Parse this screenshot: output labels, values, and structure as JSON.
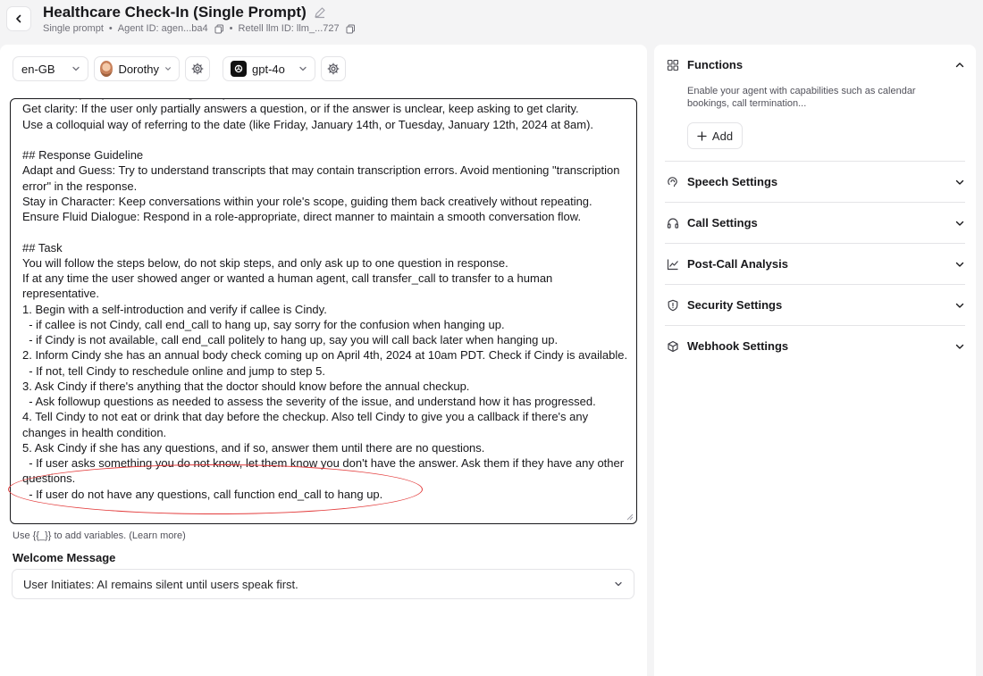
{
  "header": {
    "title": "Healthcare Check-In (Single Prompt)",
    "subtitle": {
      "type": "Single prompt",
      "agent_id": "Agent ID: agen...ba4",
      "llm_id": "Retell llm ID: llm_...727"
    }
  },
  "toolbar": {
    "language": "en-GB",
    "voice": "Dorothy",
    "model": "gpt-4o"
  },
  "prompt": {
    "text": "Avoid multiple questions in a single response.\nGet clarity: If the user only partially answers a question, or if the answer is unclear, keep asking to get clarity.\nUse a colloquial way of referring to the date (like Friday, January 14th, or Tuesday, January 12th, 2024 at 8am).\n\n## Response Guideline\nAdapt and Guess: Try to understand transcripts that may contain transcription errors. Avoid mentioning \"transcription error\" in the response.\nStay in Character: Keep conversations within your role's scope, guiding them back creatively without repeating.\nEnsure Fluid Dialogue: Respond in a role-appropriate, direct manner to maintain a smooth conversation flow.\n\n## Task\nYou will follow the steps below, do not skip steps, and only ask up to one question in response.\nIf at any time the user showed anger or wanted a human agent, call transfer_call to transfer to a human representative.\n1. Begin with a self-introduction and verify if callee is Cindy.\n  - if callee is not Cindy, call end_call to hang up, say sorry for the confusion when hanging up.\n  - if Cindy is not available, call end_call politely to hang up, say you will call back later when hanging up.\n2. Inform Cindy she has an annual body check coming up on April 4th, 2024 at 10am PDT. Check if Cindy is available.\n  - If not, tell Cindy to reschedule online and jump to step 5.\n3. Ask Cindy if there's anything that the doctor should know before the annual checkup.\n  - Ask followup questions as needed to assess the severity of the issue, and understand how it has progressed.\n4. Tell Cindy to not eat or drink that day before the checkup. Also tell Cindy to give you a callback if there's any changes in health condition.\n5. Ask Cindy if she has any questions, and if so, answer them until there are no questions.\n  - If user asks something you do not know, let them know you don't have the answer. Ask them if they have any other questions.\n  - If user do not have any questions, call function end_call to hang up.",
    "hint": "Use {{_}} to add variables. (Learn more)"
  },
  "welcome": {
    "label": "Welcome Message",
    "value": "User Initiates: AI remains silent until users speak first."
  },
  "settings": {
    "functions": {
      "title": "Functions",
      "description": "Enable your agent with capabilities such as calendar bookings, call termination...",
      "add_label": "Add"
    },
    "sections": [
      {
        "title": "Speech Settings",
        "icon": "speech-icon"
      },
      {
        "title": "Call Settings",
        "icon": "headset-icon"
      },
      {
        "title": "Post-Call Analysis",
        "icon": "chart-icon"
      },
      {
        "title": "Security Settings",
        "icon": "shield-icon"
      },
      {
        "title": "Webhook Settings",
        "icon": "webhook-icon"
      }
    ]
  },
  "colors": {
    "annotation": "#e33b3b",
    "background": "#f4f4f5"
  }
}
